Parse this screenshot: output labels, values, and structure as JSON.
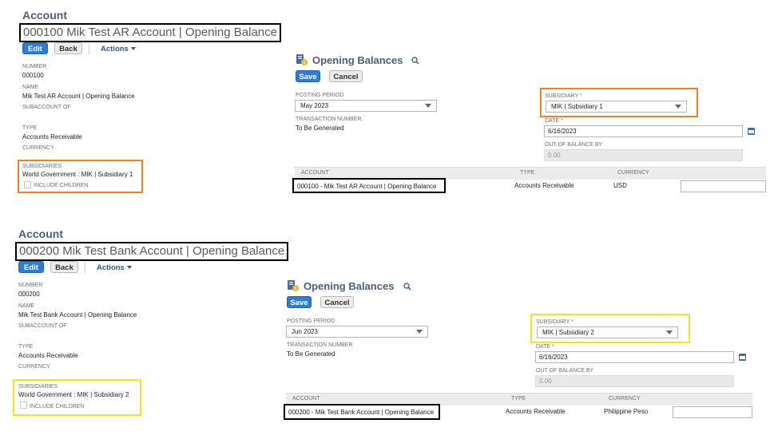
{
  "top": {
    "section_title": "Account",
    "record_title": "000100 Mik Test AR Account | Opening Balance",
    "edit_label": "Edit",
    "back_label": "Back",
    "actions_label": "Actions",
    "number_label": "NUMBER",
    "number_value": "000100",
    "name_label": "NAME",
    "name_value": "Mik Test AR Account | Opening Balance",
    "subaccount_label": "SUBACCOUNT OF",
    "type_label": "TYPE",
    "type_value": "Accounts Receivable",
    "currency_label": "CURRENCY",
    "subsidiaries_label": "SUBSIDIARIES",
    "subsidiaries_value": "World Government : MIK | Subsidiary 1",
    "include_children_label": "INCLUDE CHILDREN",
    "ob": {
      "title": "Opening Balances",
      "save_label": "Save",
      "cancel_label": "Cancel",
      "posting_period_label": "POSTING PERIOD",
      "posting_period_value": "May 2023",
      "transaction_number_label": "TRANSACTION NUMBER",
      "transaction_number_value": "To Be Generated",
      "subsidiary_label": "SUBSIDIARY",
      "subsidiary_value": "MIK | Subsidiary 1",
      "date_label": "DATE",
      "date_value": "6/16/2023",
      "out_of_balance_label": "OUT OF BALANCE BY",
      "out_of_balance_value": "0.00",
      "col_account": "ACCOUNT",
      "col_type": "TYPE",
      "col_currency": "CURRENCY",
      "row_account": "000100 - Mik Test AR Account | Opening Balance",
      "row_type": "Accounts Receivable",
      "row_currency": "USD"
    }
  },
  "bottom": {
    "section_title": "Account",
    "record_title": "000200 Mik Test Bank Account | Opening Balance",
    "edit_label": "Edit",
    "back_label": "Back",
    "actions_label": "Actions",
    "number_label": "NUMBER",
    "number_value": "000200",
    "name_label": "NAME",
    "name_value": "Mik Test Bank Account | Opening Balance",
    "subaccount_label": "SUBACCOUNT OF",
    "type_label": "TYPE",
    "type_value": "Accounts Receivable",
    "currency_label": "CURRENCY",
    "subsidiaries_label": "SUBSIDIARIES",
    "subsidiaries_value": "World Government : MIK | Subsidiary 2",
    "include_children_label": "INCLUDE CHILDREN",
    "ob": {
      "title": "Opening Balances",
      "save_label": "Save",
      "cancel_label": "Cancel",
      "posting_period_label": "POSTING PERIOD",
      "posting_period_value": "Jun 2023",
      "transaction_number_label": "TRANSACTION NUMBER",
      "transaction_number_value": "To Be Generated",
      "subsidiary_label": "SUBSIDIARY",
      "subsidiary_value": "MIK | Subsidiary 2",
      "date_label": "DATE",
      "date_value": "6/16/2023",
      "out_of_balance_label": "OUT OF BALANCE BY",
      "out_of_balance_value": "0.00",
      "col_account": "ACCOUNT",
      "col_type": "TYPE",
      "col_currency": "CURRENCY",
      "row_account": "000200 - Mik Test Bank Account | Opening Balance",
      "row_type": "Accounts Receivable",
      "row_currency": "Philippine Peso"
    }
  },
  "colors": {
    "annotation_black": "#000000",
    "annotation_orange": "#f07f1f",
    "annotation_yellow": "#f5e61a",
    "primary_button": "#2f7cd6",
    "title_blue": "#4d5f79"
  },
  "icons": [
    "document-coin-icon",
    "search-icon",
    "chevron-down-icon",
    "calendar-icon",
    "checkbox-icon"
  ]
}
